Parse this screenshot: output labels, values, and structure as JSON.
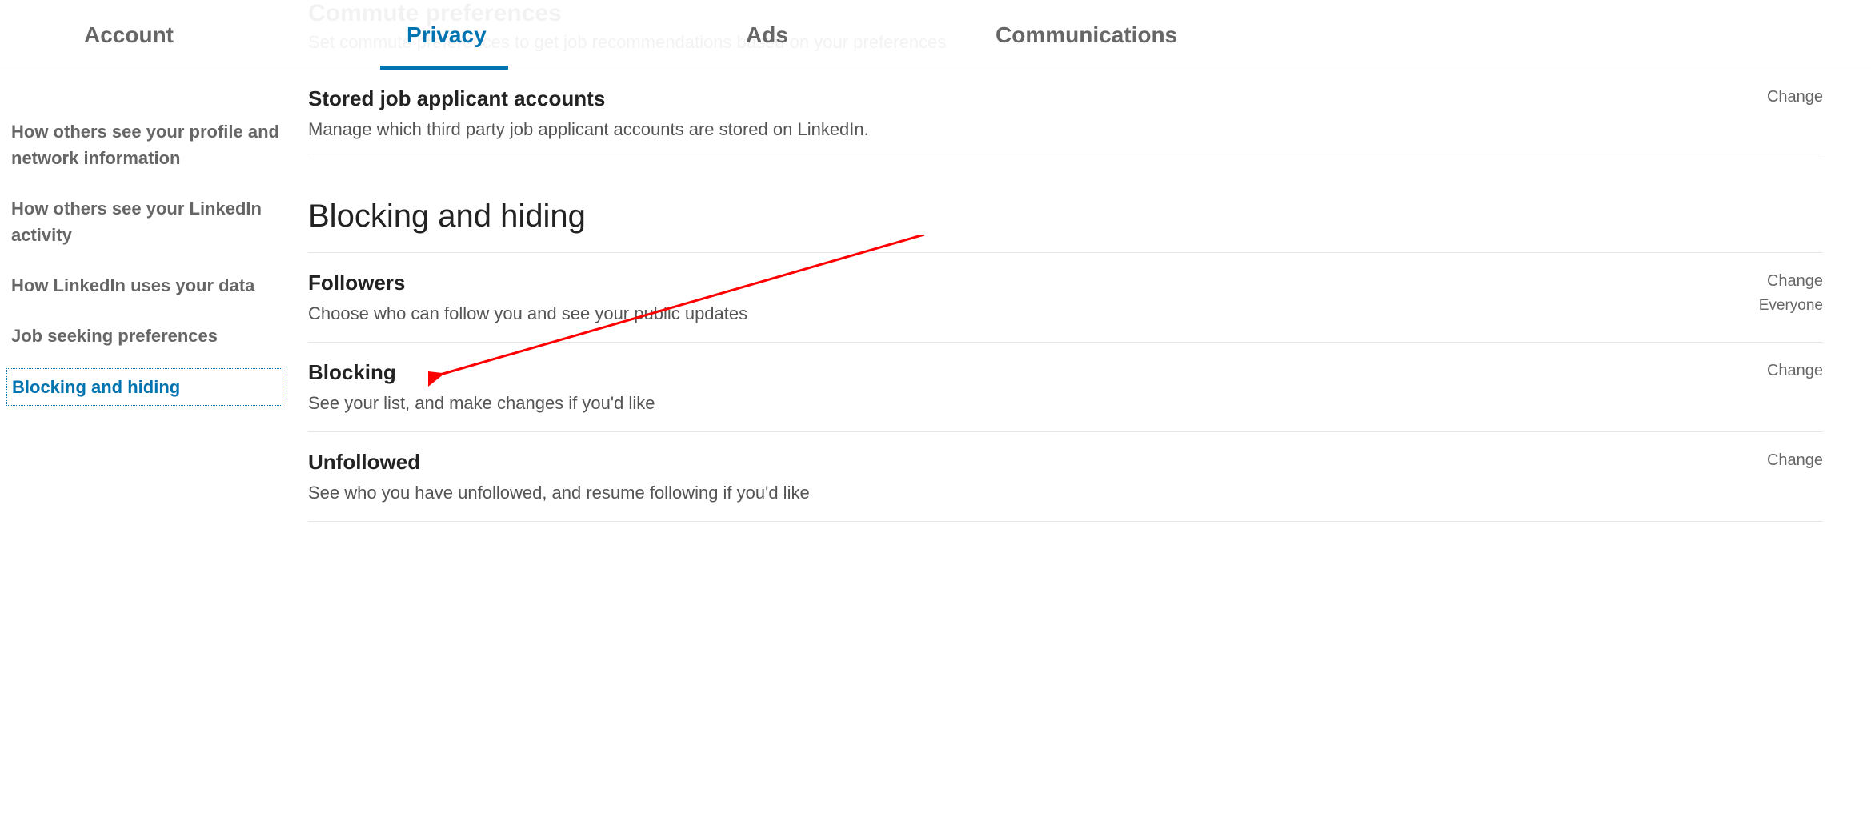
{
  "top_nav": {
    "account": "Account",
    "privacy": "Privacy",
    "ads": "Ads",
    "communications": "Communications"
  },
  "faded": {
    "title": "Commute preferences",
    "desc": "Set commute preferences to get job recommendations based on your preferences"
  },
  "sidebar": {
    "items": [
      "How others see your profile and network information",
      "How others see your LinkedIn activity",
      "How LinkedIn uses your data",
      "Job seeking preferences",
      "Blocking and hiding"
    ]
  },
  "settings": {
    "stored_job": {
      "title": "Stored job applicant accounts",
      "desc": "Manage which third party job applicant accounts are stored on LinkedIn.",
      "change": "Change"
    },
    "section_header": "Blocking and hiding",
    "followers": {
      "title": "Followers",
      "desc": "Choose who can follow you and see your public updates",
      "change": "Change",
      "value": "Everyone"
    },
    "blocking": {
      "title": "Blocking",
      "desc": "See your list, and make changes if you'd like",
      "change": "Change"
    },
    "unfollowed": {
      "title": "Unfollowed",
      "desc": "See who you have unfollowed, and resume following if you'd like",
      "change": "Change"
    }
  }
}
